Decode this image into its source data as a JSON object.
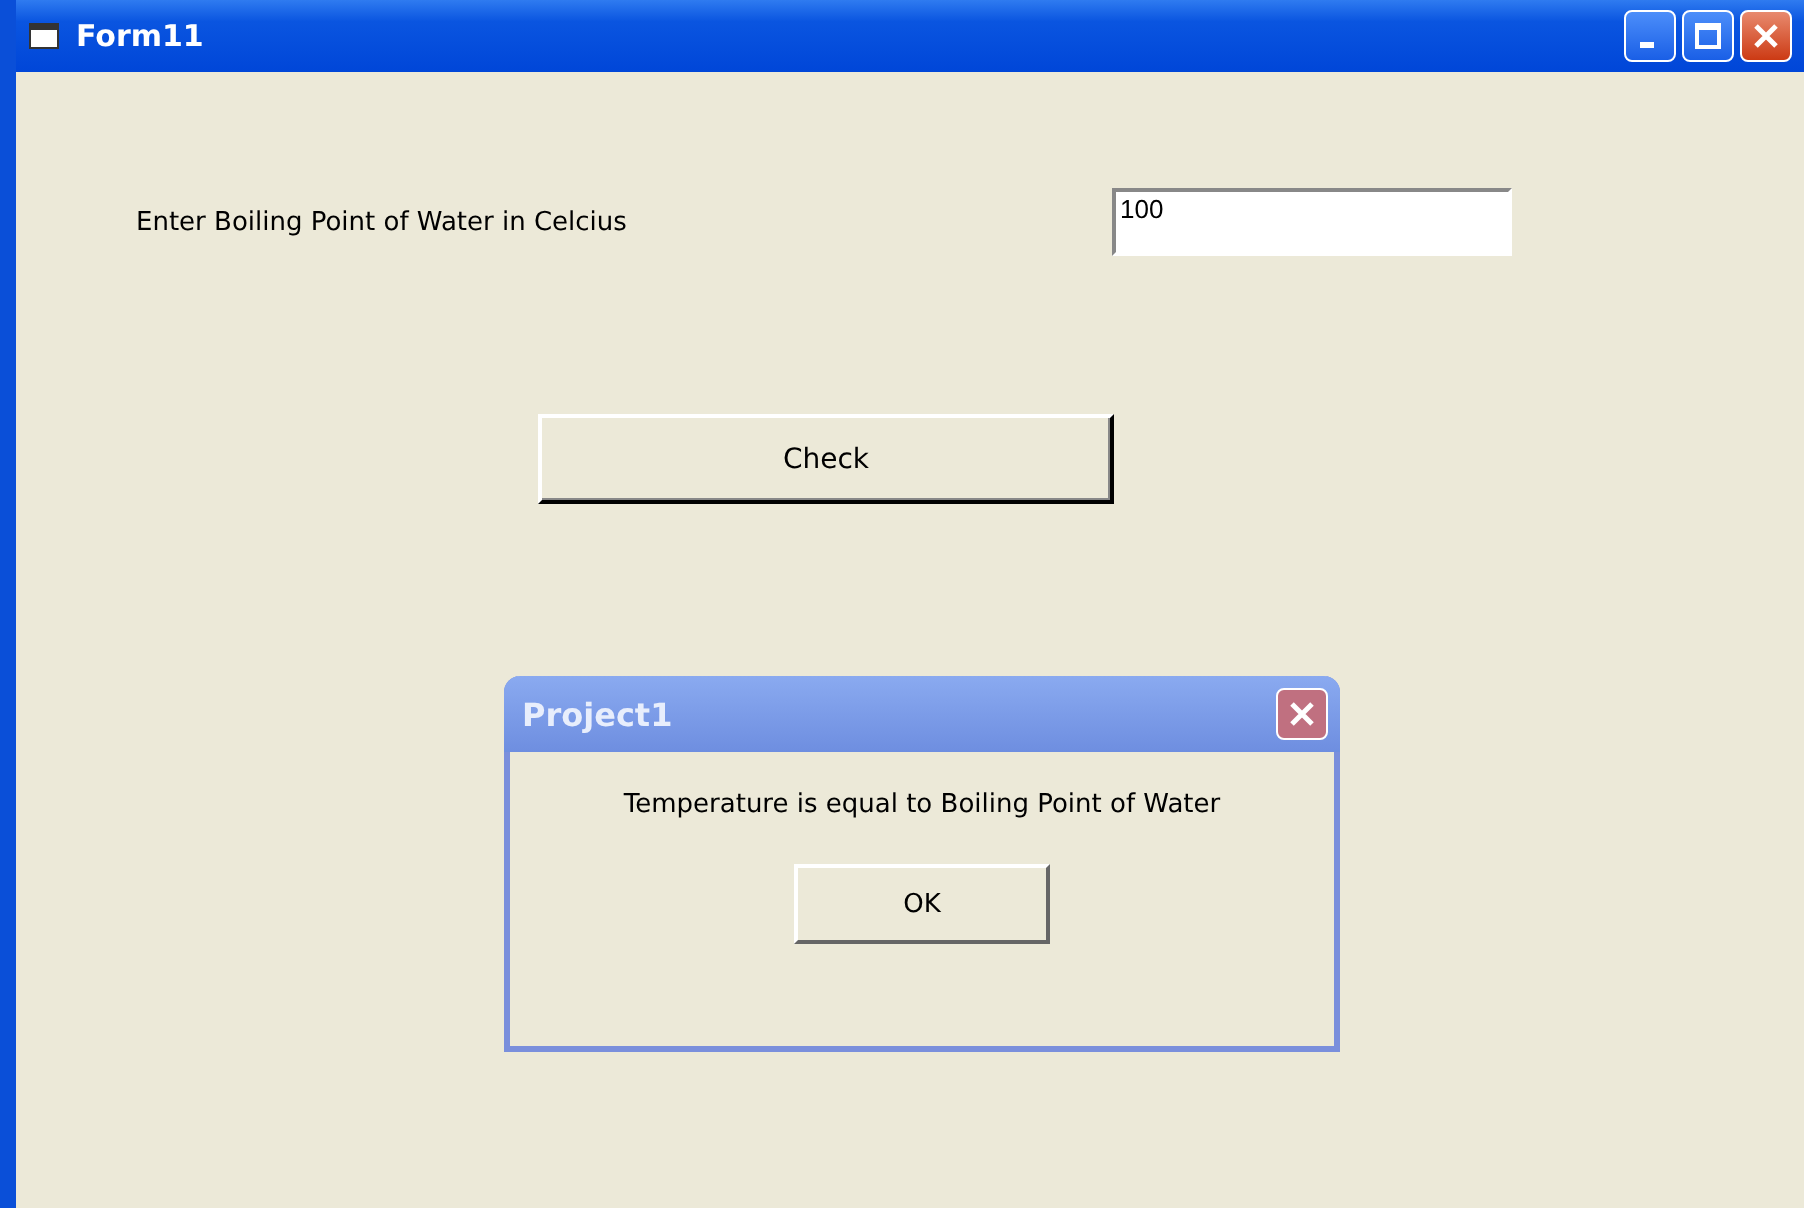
{
  "window": {
    "title": "Form11"
  },
  "form": {
    "label": "Enter Boiling Point of Water in Celcius",
    "input_value": "100",
    "button": "Check"
  },
  "dialog": {
    "title": "Project1",
    "message": "Temperature is equal to Boiling Point of Water",
    "button": "OK"
  }
}
